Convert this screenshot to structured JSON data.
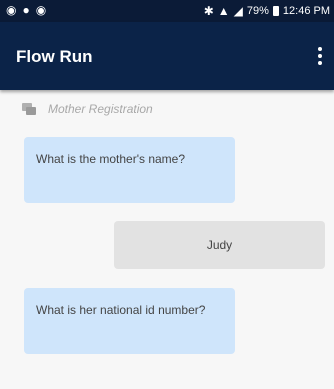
{
  "status_bar": {
    "left_icons": [
      "headset-icon",
      "location-icon",
      "sync-icon"
    ],
    "right_icons": [
      "bluetooth-icon",
      "wifi-icon",
      "signal-icon"
    ],
    "battery": "79%",
    "time": "12:46 PM",
    "colors": {
      "background": "#0b1b37",
      "text": "#ffffff"
    }
  },
  "app_bar": {
    "title": "Flow Run",
    "menu_icon": "more-vert-icon",
    "colors": {
      "background": "#0b2348",
      "text": "#ffffff"
    }
  },
  "flow": {
    "icon": "chat-icon",
    "name": "Mother Registration"
  },
  "messages": [
    {
      "direction": "incoming",
      "text": "What is the mother's name?"
    },
    {
      "direction": "outgoing",
      "text": "Judy"
    },
    {
      "direction": "incoming",
      "text": "What is her national id number?"
    }
  ],
  "colors": {
    "page_background": "#f7f7f7",
    "incoming_bubble": "#cfe5fb",
    "outgoing_bubble": "#e2e2e2",
    "message_text": "#444444",
    "flow_name_text": "#a8a8a8"
  }
}
